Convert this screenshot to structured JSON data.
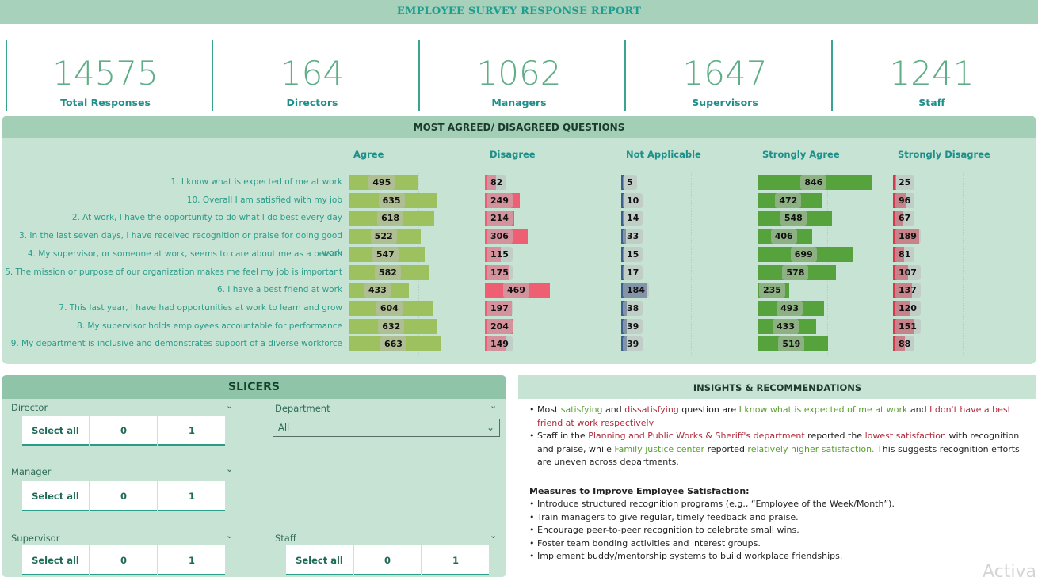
{
  "title": "EMPLOYEE SURVEY RESPONSE REPORT",
  "kpis": [
    {
      "value": "14575",
      "label": "Total Responses"
    },
    {
      "value": "164",
      "label": "Directors"
    },
    {
      "value": "1062",
      "label": "Managers"
    },
    {
      "value": "1647",
      "label": "Supervisors"
    },
    {
      "value": "1241",
      "label": "Staff"
    }
  ],
  "questions_section": {
    "title": "MOST AGREED/ DISAGREED QUESTIONS",
    "columns": [
      "Agree",
      "Disagree",
      "Not Applicable",
      "Strongly Agree",
      "Strongly Disagree"
    ],
    "colors": {
      "Agree": "#9dc15f",
      "Disagree": "#ef5f73",
      "Not Applicable": "#3c5f8f",
      "Strongly Agree": "#56a23d",
      "Strongly Disagree": "#d33a4c"
    },
    "rows": [
      {
        "question": "1. I know what is expected of me at work",
        "values": [
          495,
          82,
          5,
          846,
          25
        ]
      },
      {
        "question": "10. Overall I am satisfied with my job",
        "values": [
          635,
          249,
          10,
          472,
          96
        ]
      },
      {
        "question": "2. At work, I have the opportunity to do what I do best every day",
        "values": [
          618,
          214,
          14,
          548,
          67
        ]
      },
      {
        "question": "3. In the last seven days, I have received recognition or praise for doing good work",
        "values": [
          522,
          306,
          33,
          406,
          189
        ]
      },
      {
        "question": "4. My supervisor, or someone at work, seems to care about me as a person",
        "values": [
          547,
          115,
          15,
          699,
          81
        ]
      },
      {
        "question": "5. The mission or purpose of our organization makes me feel my job is important",
        "values": [
          582,
          175,
          17,
          578,
          107
        ]
      },
      {
        "question": "6. I have a best friend at work",
        "values": [
          433,
          469,
          184,
          235,
          137
        ]
      },
      {
        "question": "7. This last year, I have had opportunities at work to learn and grow",
        "values": [
          604,
          197,
          38,
          493,
          120
        ]
      },
      {
        "question": "8. My supervisor holds employees accountable for performance",
        "values": [
          632,
          204,
          39,
          433,
          151
        ]
      },
      {
        "question": "9. My department is inclusive and demonstrates support of a diverse workforce",
        "values": [
          663,
          149,
          39,
          519,
          88
        ]
      }
    ]
  },
  "slicers": {
    "title": "SLICERS",
    "director": {
      "label": "Director",
      "options": [
        "Select all",
        "0",
        "1"
      ]
    },
    "manager": {
      "label": "Manager",
      "options": [
        "Select all",
        "0",
        "1"
      ]
    },
    "supervisor": {
      "label": "Supervisor",
      "options": [
        "Select all",
        "0",
        "1"
      ]
    },
    "staff": {
      "label": "Staff",
      "options": [
        "Select all",
        "0",
        "1"
      ]
    },
    "department": {
      "label": "Department",
      "value": "All"
    }
  },
  "insights": {
    "title": "INSIGHTS & RECOMMENDATIONS",
    "p1": {
      "t1": "Most ",
      "t2": "satisfying",
      "t3": " and ",
      "t4": "dissatisfying",
      "t5": " question are ",
      "t6": "I know what is expected of me at work",
      "t7": " and ",
      "t8": "I don't have a best friend at work respectively"
    },
    "p2": {
      "t1": "Staff in the ",
      "t2": "Planning and Public Works & Sheriff's department",
      "t3": " reported the ",
      "t4": "lowest satisfaction",
      "t5": " with recognition and praise, while ",
      "t6": "Family justice center",
      "t7": " reported ",
      "t8": "relatively higher satisfaction.",
      "t9": " This suggests recognition efforts are uneven across departments."
    },
    "measures_title": "Measures to Improve Employee Satisfaction:",
    "measures": [
      "Introduce structured recognition programs (e.g., “Employee of the Week/Month”).",
      "Train managers to give regular, timely feedback and praise.",
      "Encourage peer-to-peer recognition to celebrate small wins.",
      "Foster team bonding activities and interest groups.",
      "Implement buddy/mentorship systems to build workplace friendships."
    ],
    "watermark": "Activa"
  }
}
